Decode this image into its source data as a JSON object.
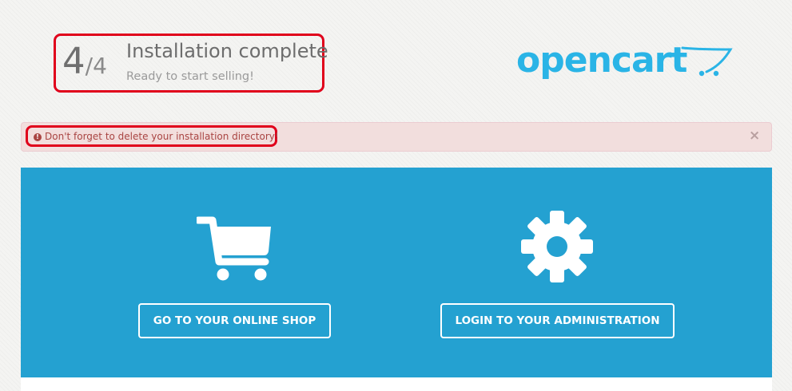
{
  "header": {
    "step_current": "4",
    "step_total": "/4",
    "title": "Installation complete",
    "subtitle": "Ready to start selling!"
  },
  "logo": {
    "text": "opencart",
    "icon": "cart-logo-icon",
    "color": "#2ab4e6"
  },
  "alert": {
    "icon": "exclamation-circle-icon",
    "message": "Don't forget to delete your installation directory!",
    "close_label": "×"
  },
  "actions": {
    "shop": {
      "icon": "shopping-cart-icon",
      "label": "GO TO YOUR ONLINE SHOP"
    },
    "admin": {
      "icon": "gear-icon",
      "label": "LOGIN TO YOUR ADMINISTRATION"
    }
  },
  "colors": {
    "panel": "#24a1d1",
    "highlight": "#e0001b",
    "alert_bg": "#f2dedd",
    "alert_text": "#a94442"
  }
}
